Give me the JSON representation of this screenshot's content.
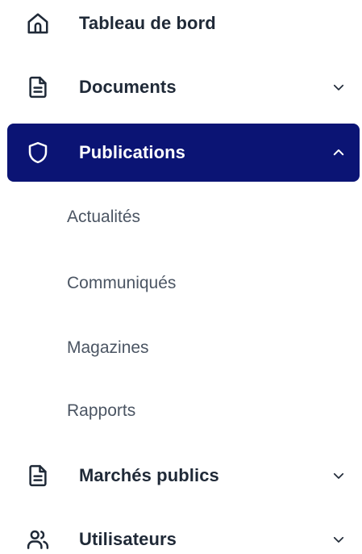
{
  "sidebar": {
    "items": [
      {
        "label": "Tableau de bord",
        "icon": "home-icon",
        "has_chevron": false
      },
      {
        "label": "Documents",
        "icon": "document-icon",
        "has_chevron": true,
        "expanded": false
      },
      {
        "label": "Publications",
        "icon": "shield-icon",
        "has_chevron": true,
        "expanded": true,
        "active": true,
        "children": [
          "Actualités",
          "Communiqués",
          "Magazines",
          "Rapports"
        ]
      },
      {
        "label": "Marchés publics",
        "icon": "document-icon",
        "has_chevron": true,
        "expanded": false
      },
      {
        "label": "Utilisateurs",
        "icon": "users-icon",
        "has_chevron": true,
        "expanded": false
      }
    ]
  },
  "colors": {
    "active_background": "#0b1474",
    "active_text": "#ffffff",
    "text": "#1f2937",
    "subtext": "#4b5563"
  }
}
